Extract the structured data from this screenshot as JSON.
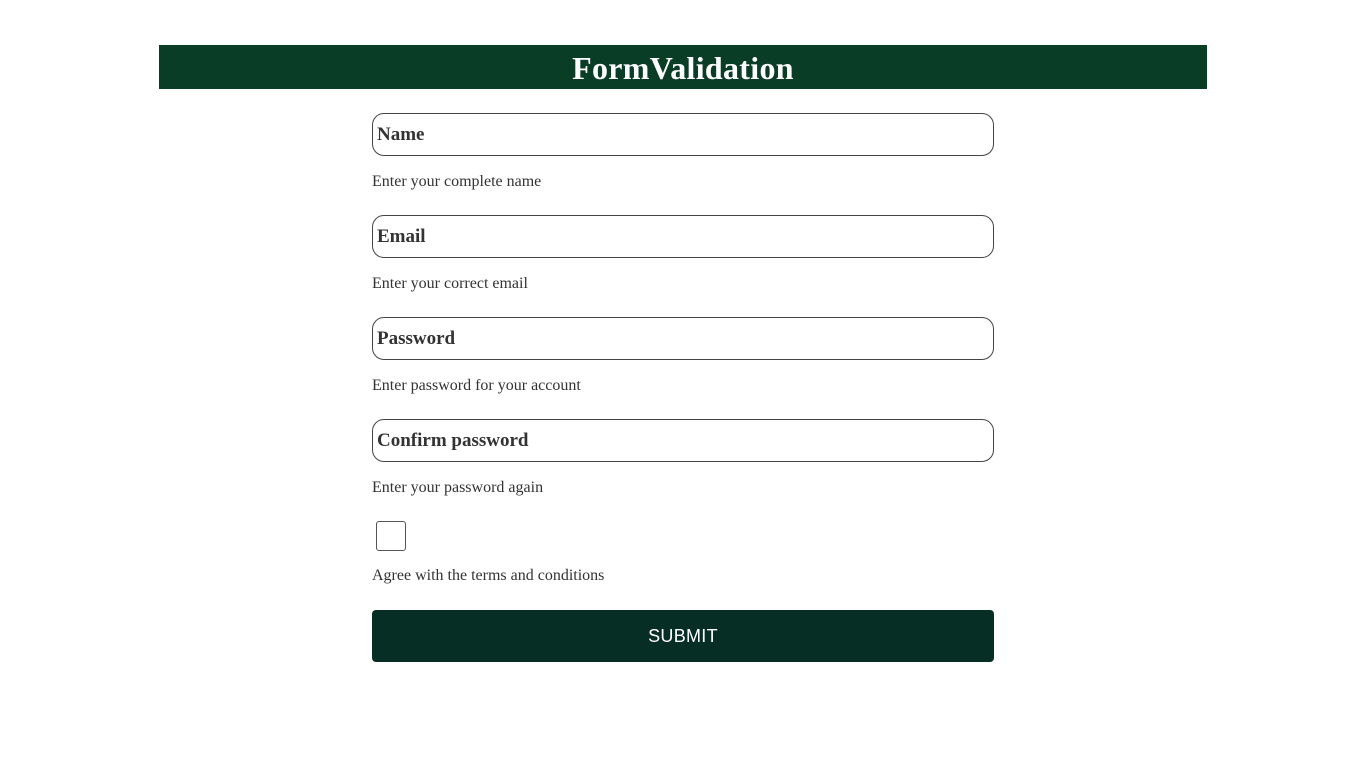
{
  "header": {
    "title": "FormValidation",
    "background_color": "#0a3d26"
  },
  "form": {
    "fields": [
      {
        "placeholder": "Name",
        "value": "",
        "hint": "Enter your complete name"
      },
      {
        "placeholder": "Email",
        "value": "",
        "hint": "Enter your correct email"
      },
      {
        "placeholder": "Password",
        "value": "",
        "hint": "Enter password for your account"
      },
      {
        "placeholder": "Confirm password",
        "value": "",
        "hint": "Enter your password again"
      }
    ],
    "terms": {
      "checked": false,
      "label": "Agree with the terms and conditions"
    },
    "submit": {
      "label": "SUBMIT",
      "background_color": "#062e24"
    }
  }
}
